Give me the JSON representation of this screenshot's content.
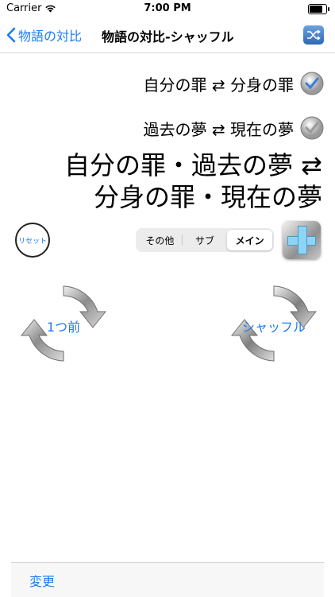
{
  "status": {
    "carrier": "Carrier",
    "time": "7:00 PM",
    "battery_level": 0.9
  },
  "nav": {
    "back_label": "物語の対比",
    "title": "物語の対比-シャッフル",
    "shuffle_icon": "shuffle-icon"
  },
  "rules": [
    {
      "text": "自分の罪 ⇄ 分身の罪",
      "checked": true
    },
    {
      "text": "過去の夢 ⇄ 現在の夢",
      "checked": true
    }
  ],
  "combined": {
    "line1": "自分の罪・過去の夢 ⇄",
    "line2": "分身の罪・現在の夢"
  },
  "controls": {
    "reset_label": "リセット",
    "segments": [
      "その他",
      "サブ",
      "メイン"
    ],
    "selected_segment": "メイン"
  },
  "actions": {
    "previous_label": "1つ前",
    "shuffle_label": "シャッフル"
  },
  "bottom": {
    "change_label": "変更"
  },
  "colors": {
    "accent": "#1a7cf5",
    "check": "#3b7fd6"
  }
}
